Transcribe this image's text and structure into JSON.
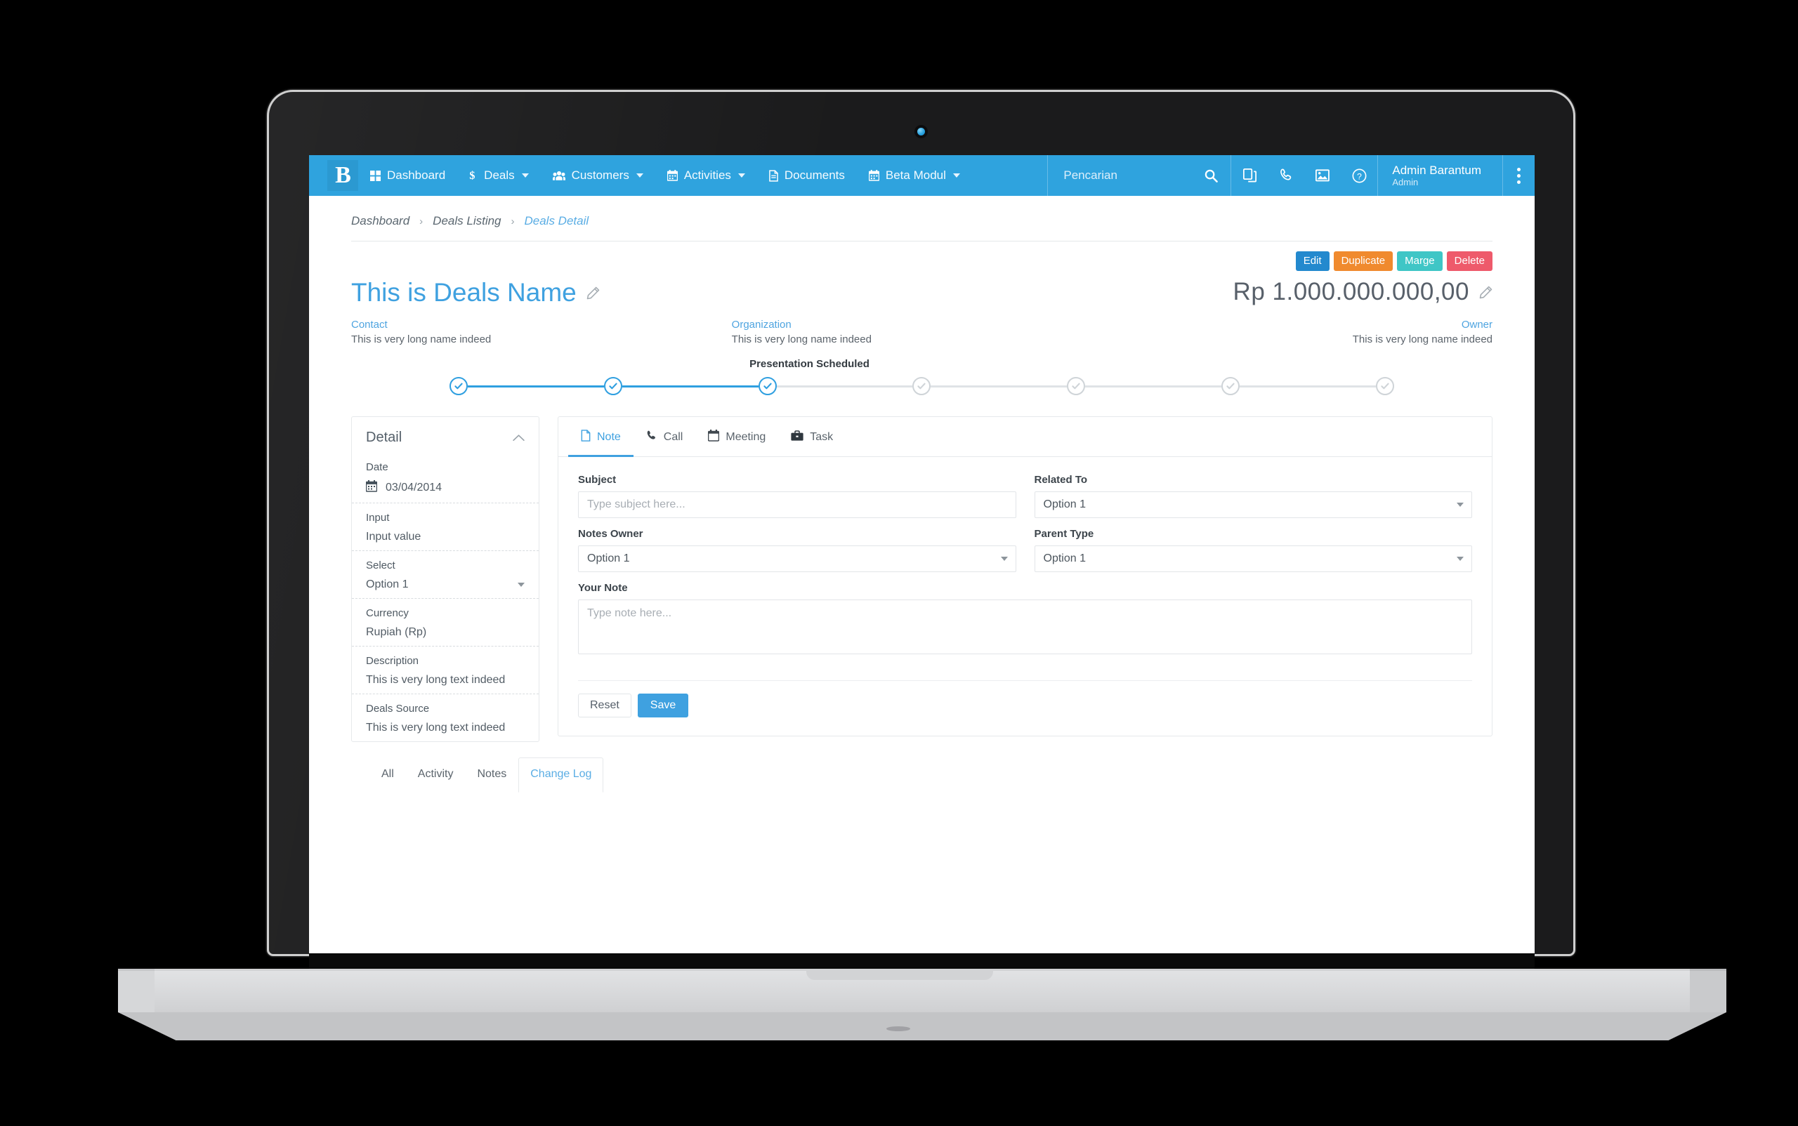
{
  "topnav": {
    "brand": "B",
    "items": [
      {
        "label": "Dashboard",
        "icon": "grid-icon",
        "caret": false
      },
      {
        "label": "Deals",
        "icon": "dollar-icon",
        "caret": true
      },
      {
        "label": "Customers",
        "icon": "people-icon",
        "caret": true
      },
      {
        "label": "Activities",
        "icon": "calendar-icon",
        "caret": true
      },
      {
        "label": "Documents",
        "icon": "document-icon",
        "caret": false
      },
      {
        "label": "Beta Modul",
        "icon": "calendar-icon",
        "caret": true
      }
    ],
    "search": {
      "placeholder": "Pencarian",
      "value": "Pencarian",
      "icon": "search-icon"
    },
    "icons": [
      "copy-icon",
      "phone-icon",
      "image-icon",
      "help-icon"
    ],
    "user": {
      "name": "Admin Barantum",
      "role": "Admin"
    },
    "accent_color": "#2fa3de"
  },
  "breadcrumb": {
    "items": [
      {
        "label": "Dashboard",
        "active": false
      },
      {
        "label": "Deals Listing",
        "active": false
      },
      {
        "label": "Deals Detail",
        "active": true
      }
    ],
    "separator": "›"
  },
  "actions": [
    {
      "label": "Edit",
      "color": "#2389ce"
    },
    {
      "label": "Duplicate",
      "color": "#f08a2e"
    },
    {
      "label": "Marge",
      "color": "#3fc6c6"
    },
    {
      "label": "Delete",
      "color": "#ee5a6b"
    }
  ],
  "deal": {
    "title": "This is Deals Name",
    "amount": "Rp 1.000.000.000,00",
    "meta": [
      {
        "label": "Contact",
        "value": "This is very long name indeed"
      },
      {
        "label": "Organization",
        "value": "This is very long name indeed"
      },
      {
        "label": "Owner",
        "value": "This is very long name indeed"
      }
    ]
  },
  "stage": {
    "current_label": "Presentation Scheduled",
    "total_steps": 7,
    "completed_steps": 3,
    "active_color": "#2f9fe0",
    "inactive_color": "#cfd4d8"
  },
  "detail_panel": {
    "title": "Detail",
    "fields": [
      {
        "label": "Date",
        "value": "03/04/2014",
        "type": "date"
      },
      {
        "label": "Input",
        "value": "Input value",
        "type": "text"
      },
      {
        "label": "Select",
        "value": "Option 1",
        "type": "select"
      },
      {
        "label": "Currency",
        "value": "Rupiah (Rp)",
        "type": "text"
      },
      {
        "label": "Description",
        "value": "This is very long text indeed",
        "type": "text"
      },
      {
        "label": "Deals Source",
        "value": "This is very long text indeed",
        "type": "text"
      }
    ]
  },
  "activity_panel": {
    "tabs": [
      {
        "label": "Note",
        "icon": "file-icon",
        "active": true
      },
      {
        "label": "Call",
        "icon": "phone-icon",
        "active": false
      },
      {
        "label": "Meeting",
        "icon": "calendar-icon",
        "active": false
      },
      {
        "label": "Task",
        "icon": "briefcase-icon",
        "active": false
      }
    ],
    "form": {
      "subject": {
        "label": "Subject",
        "placeholder": "Type subject here...",
        "value": ""
      },
      "related_to": {
        "label": "Related To",
        "value": "Option 1"
      },
      "notes_owner": {
        "label": "Notes Owner",
        "value": "Option 1"
      },
      "parent_type": {
        "label": "Parent Type",
        "value": "Option 1"
      },
      "your_note": {
        "label": "Your Note",
        "placeholder": "Type note here...",
        "value": ""
      },
      "reset_label": "Reset",
      "save_label": "Save"
    }
  },
  "bottom_tabs": [
    {
      "label": "All",
      "active": false
    },
    {
      "label": "Activity",
      "active": false
    },
    {
      "label": "Notes",
      "active": false
    },
    {
      "label": "Change Log",
      "active": true
    }
  ]
}
